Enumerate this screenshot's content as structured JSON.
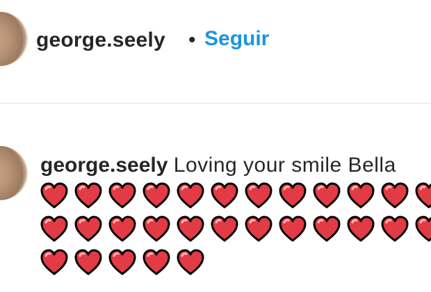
{
  "post_header": {
    "username": "george.seely",
    "separator": "•",
    "follow_label": "Seguir"
  },
  "comment": {
    "username": "george.seely",
    "text": "Loving your smile Bella",
    "heart_rows": [
      12,
      12,
      5
    ]
  },
  "colors": {
    "link_blue": "#1b95e0",
    "text": "#262626",
    "heart": "#e23b45",
    "heart_outline": "#000000"
  },
  "icons": {
    "avatar": "user-avatar",
    "heart": "red-heart-emoji"
  }
}
